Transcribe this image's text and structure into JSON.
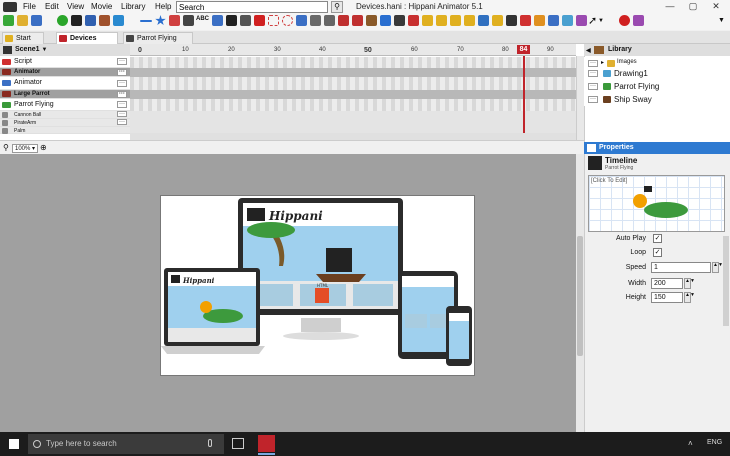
{
  "menu": {
    "items": [
      "File",
      "Edit",
      "View",
      "Movie",
      "Library",
      "Help"
    ],
    "search_value": "Search",
    "search_button": "⚲",
    "window_title": "Devices.hani : Hippani Animator 5.1",
    "minimize": "—",
    "maximize": "▢",
    "close": "✕"
  },
  "toolbar": {
    "text_tool": "ABC"
  },
  "tabs": [
    {
      "label": "Start"
    },
    {
      "label": "Devices"
    },
    {
      "label": "Parrot Flying"
    }
  ],
  "timeline": {
    "scene_label": "Scene1",
    "option_glyph": "···",
    "layers": [
      {
        "name": "Script"
      },
      {
        "name": "Animator"
      },
      {
        "name": "Animator"
      },
      {
        "name": "Large Parrot"
      },
      {
        "name": "Parrot Flying"
      },
      {
        "name": "Cannon Ball"
      },
      {
        "name": "PirateArm"
      },
      {
        "name": "Palm"
      }
    ],
    "ruler_labels": [
      "0",
      "10",
      "20",
      "30",
      "40",
      "50",
      "60",
      "70",
      "80",
      "84",
      "90"
    ],
    "current_frame": "84"
  },
  "zoom": {
    "value": "100%"
  },
  "library": {
    "title": "Library",
    "items": [
      {
        "name": "Images"
      },
      {
        "name": "Drawing1"
      },
      {
        "name": "Parrot Flying"
      },
      {
        "name": "Ship Sway"
      }
    ]
  },
  "properties": {
    "title": "Properties",
    "object_title": "Timeline",
    "object_subtitle": "Parrot Flying",
    "preview_hint": "[Click To Edit]",
    "auto_play_label": "Auto Play",
    "auto_play_checked": "✓",
    "loop_label": "Loop",
    "loop_checked": "✓",
    "speed_label": "Speed",
    "speed_value": "1",
    "width_label": "Width",
    "width_value": "200",
    "height_label": "Height",
    "height_value": "150"
  },
  "stage_art": {
    "logo_text_large": "Hippani",
    "logo_text_small": "Hippani",
    "html5_label": "HTML"
  },
  "taskbar": {
    "search_placeholder": "Type here to search",
    "language": "ENG"
  },
  "colors": {
    "accent": "#2e7ad1",
    "playhead": "#c0242b",
    "stage": "#a0a0a0"
  }
}
